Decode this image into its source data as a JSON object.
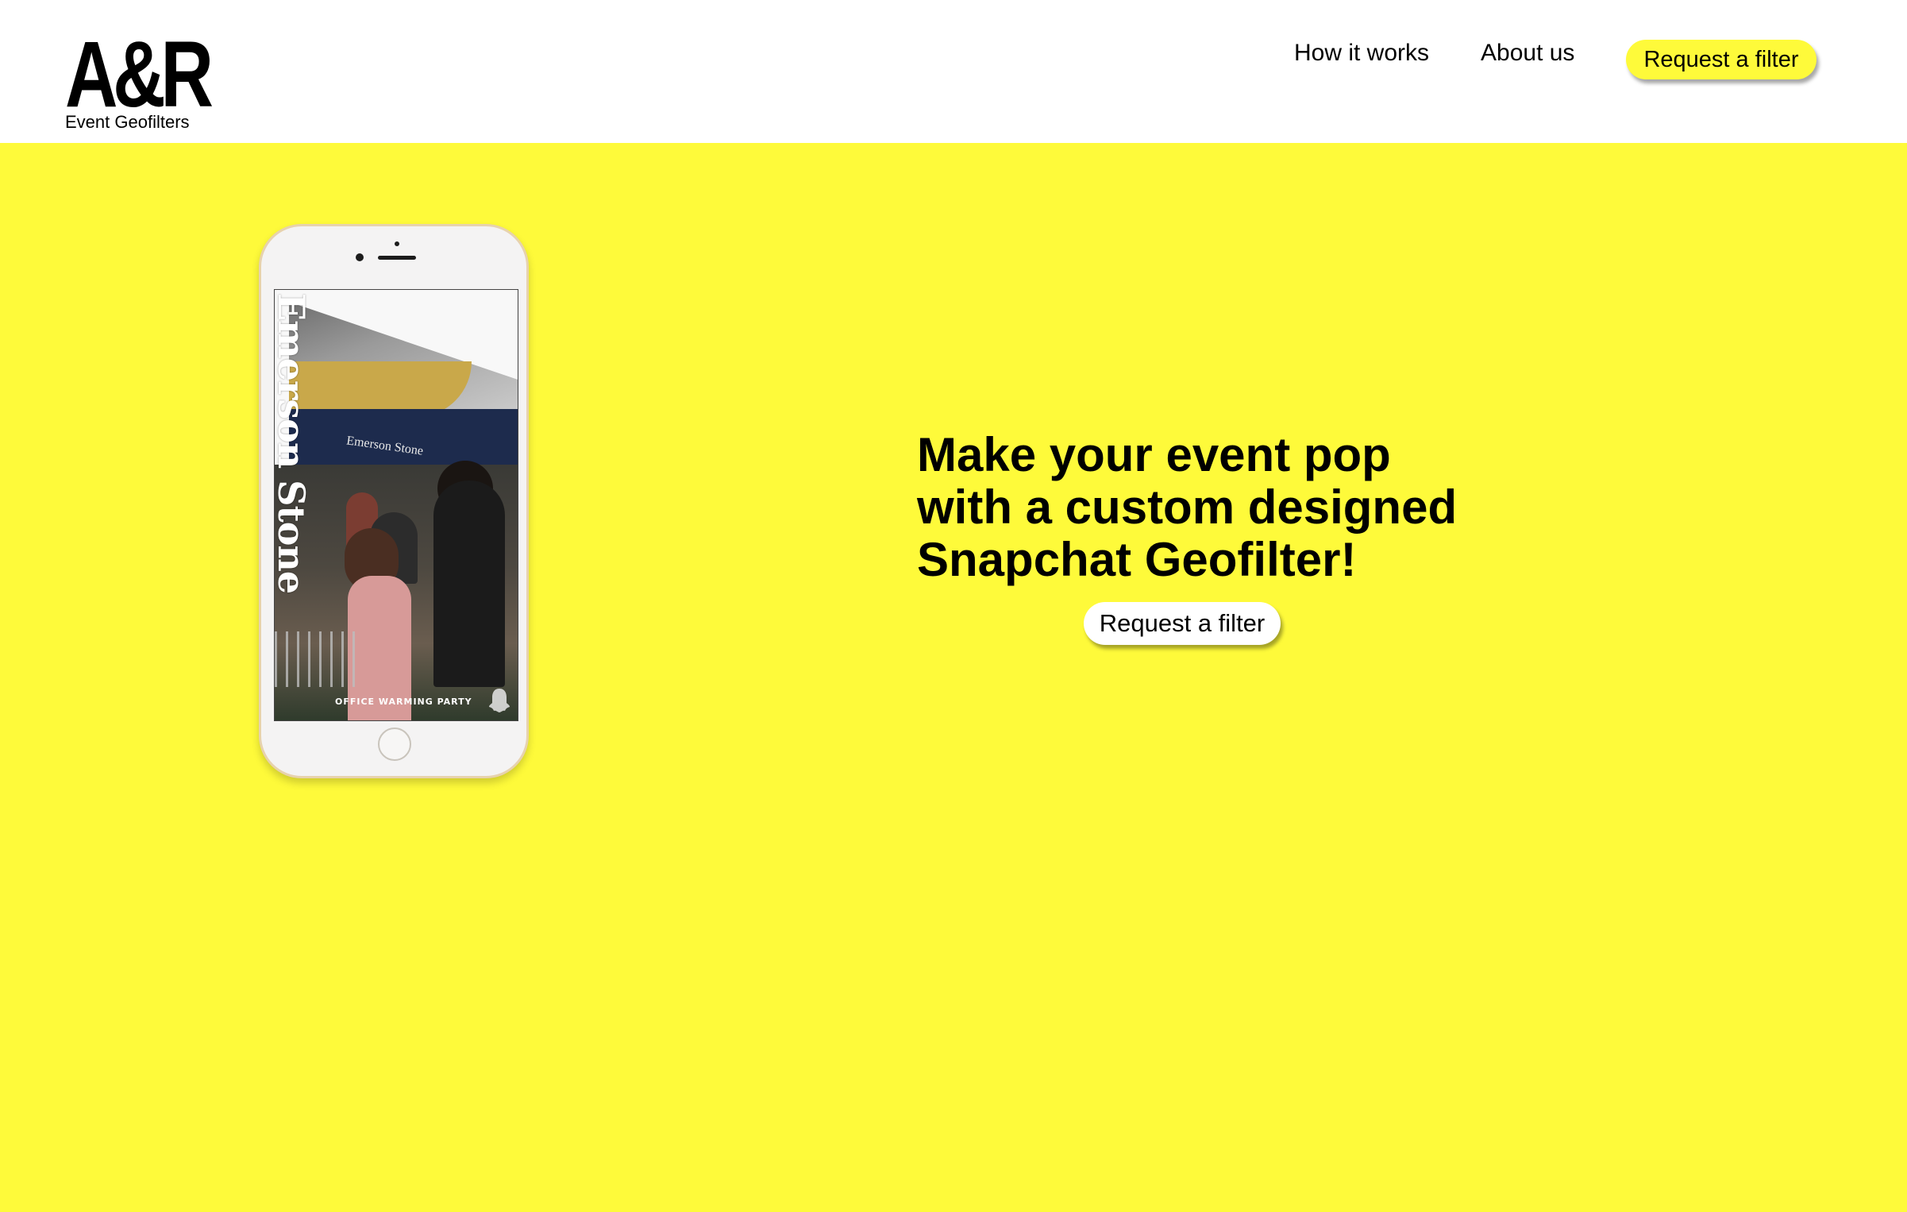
{
  "header": {
    "logo_mark": "A&R",
    "logo_sub": "Event Geofilters",
    "nav": {
      "how_it_works": "How it works",
      "about_us": "About us",
      "request_filter": "Request a filter"
    }
  },
  "hero": {
    "line1_prefix": "Make your event ",
    "line1_bold": "pop",
    "line2": "with a custom designed",
    "line3": "Snapchat Geofilter!",
    "cta": "Request a filter"
  },
  "phone_mockup": {
    "filter_title": "Emerson Stone",
    "store_sign": "Emerson Stone",
    "filter_caption": "OFFICE WARMING PARTY",
    "icon": "ghost-icon"
  },
  "colors": {
    "brand_yellow": "#fefa3a",
    "header_bg": "#ffffff",
    "text": "#000000"
  }
}
